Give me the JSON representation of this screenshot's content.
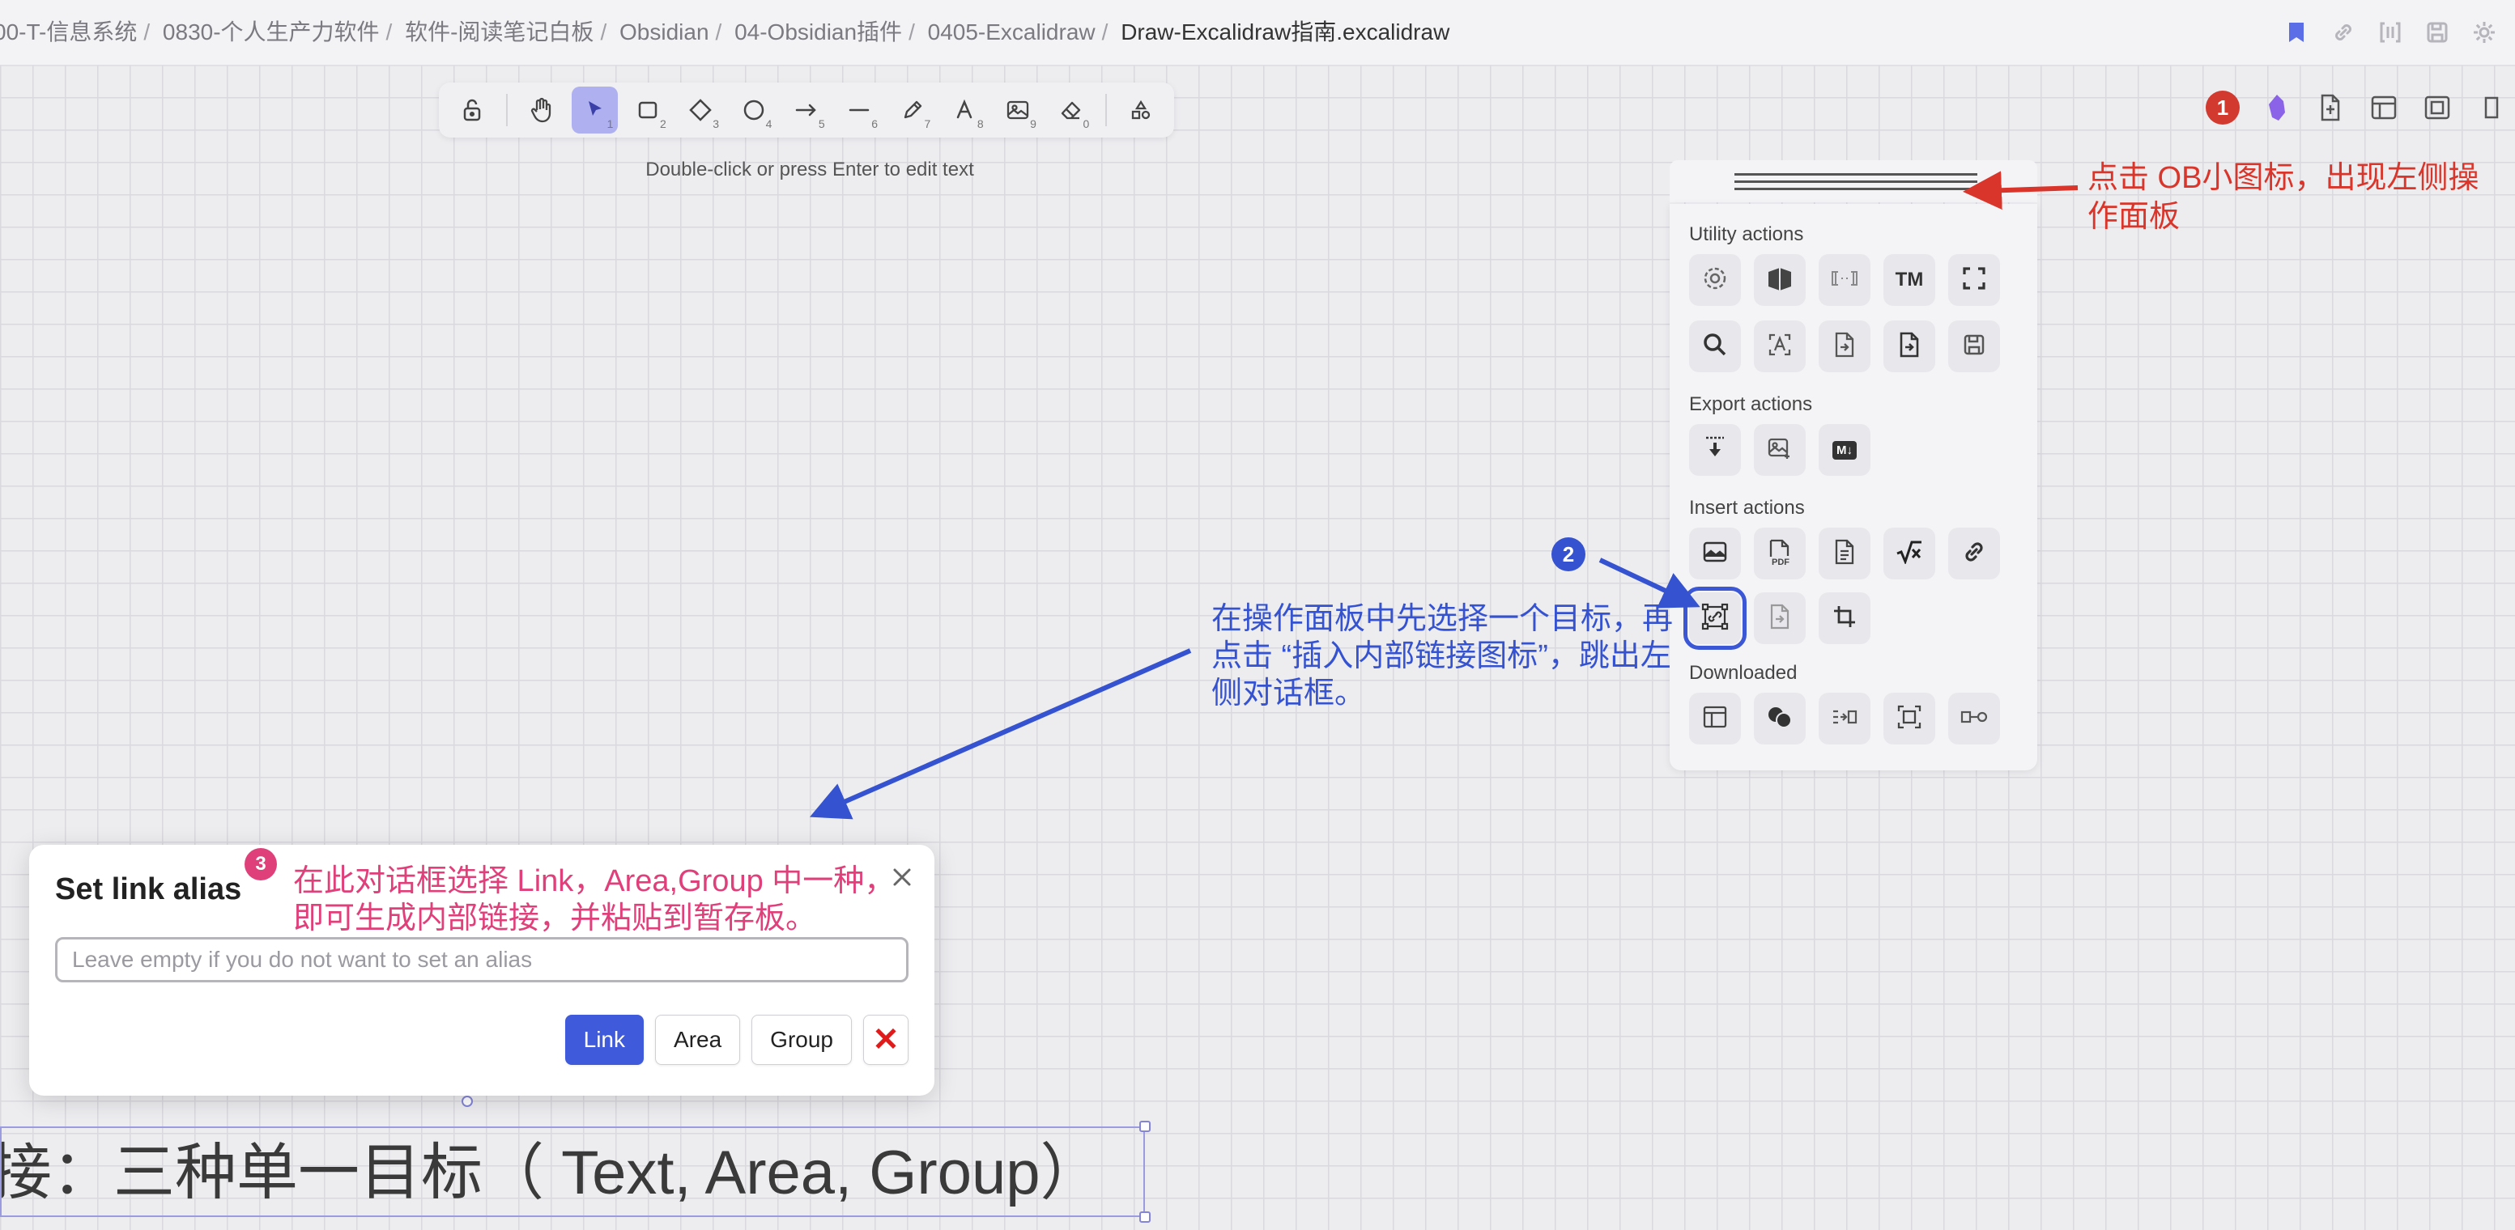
{
  "breadcrumb": {
    "items": [
      "00-T-信息系统",
      "0830-个人生产力软件",
      "软件-阅读笔记白板",
      "Obsidian",
      "04-Obsidian插件",
      "0405-Excalidraw"
    ],
    "current": "Draw-Excalidraw指南.excalidraw",
    "separator": "/"
  },
  "top_actions": [
    "bookmark-icon",
    "link-icon",
    "brackets-icon",
    "save-icon",
    "settings-icon"
  ],
  "toolbar": {
    "tools": [
      {
        "name": "lock-tool",
        "num": ""
      },
      {
        "name": "hand-tool",
        "num": ""
      },
      {
        "name": "selection-tool",
        "num": "1"
      },
      {
        "name": "rectangle-tool",
        "num": "2"
      },
      {
        "name": "diamond-tool",
        "num": "3"
      },
      {
        "name": "ellipse-tool",
        "num": "4"
      },
      {
        "name": "arrow-tool",
        "num": "5"
      },
      {
        "name": "line-tool",
        "num": "6"
      },
      {
        "name": "draw-tool",
        "num": "7"
      },
      {
        "name": "text-tool",
        "num": "8"
      },
      {
        "name": "image-tool",
        "num": "9"
      },
      {
        "name": "eraser-tool",
        "num": "0"
      },
      {
        "name": "library-tool",
        "num": ""
      }
    ]
  },
  "hint": "Double-click or press Enter to edit text",
  "right_icons": {
    "badge1": "1"
  },
  "panel": {
    "utility_title": "Utility actions",
    "export_title": "Export actions",
    "insert_title": "Insert actions",
    "downloaded_title": "Downloaded",
    "tm_label": "TM",
    "md_label": "M↓",
    "pdf_label": "PDF"
  },
  "annotations": {
    "red": "点击 OB小图标，出现左侧操作面板",
    "blue": "在操作面板中先选择一个目标，再点击 “插入内部链接图标”，跳出左侧对话框。",
    "pink": "在此对话框选择 Link，Area,Group 中一种，即可生成内部链接，并粘贴到暂存板。",
    "badge2": "2",
    "badge3": "3"
  },
  "dialog": {
    "title": "Set link alias",
    "placeholder": "Leave empty if you do not want to set an alias",
    "link_label": "Link",
    "area_label": "Area",
    "group_label": "Group",
    "cancel_label": "✕"
  },
  "canvas_text": "接：三种单一目标（ Text, Area, Group）",
  "colors": {
    "accent": "#3f5bdc",
    "annotation_red": "#d9352a",
    "annotation_blue": "#3553d0",
    "annotation_pink": "#e0407a",
    "selection": "#aeb0f0"
  }
}
